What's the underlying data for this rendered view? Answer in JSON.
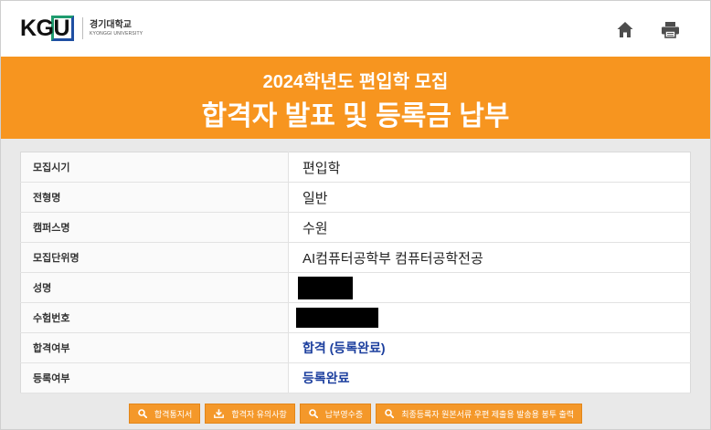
{
  "header": {
    "logo": {
      "mark": "KGU",
      "name_ko": "경기대학교",
      "name_en": "KYONGGI UNIVERSITY"
    },
    "icons": {
      "home": "home-icon",
      "print": "print-icon"
    }
  },
  "banner": {
    "subtitle": "2024학년도 편입학 모집",
    "title": "합격자 발표 및 등록금 납부"
  },
  "table": {
    "rows": [
      {
        "label": "모집시기",
        "value": "편입학"
      },
      {
        "label": "전형명",
        "value": "일반"
      },
      {
        "label": "캠퍼스명",
        "value": "수원"
      },
      {
        "label": "모집단위명",
        "value": "AI컴퓨터공학부 컴퓨터공학전공"
      },
      {
        "label": "성명"
      },
      {
        "label": "수험번호"
      },
      {
        "label": "합격여부",
        "value": "합격 (등록완료)"
      },
      {
        "label": "등록여부",
        "value": "등록완료"
      }
    ]
  },
  "actions": [
    {
      "label": "합격통지서",
      "icon": "search-icon"
    },
    {
      "label": "합격자 유의사항",
      "icon": "download-icon"
    },
    {
      "label": "납부영수증",
      "icon": "search-icon"
    },
    {
      "label": "최종등록자 원본서류 우편 제출용 발송용 봉투 출력",
      "icon": "search-icon"
    }
  ],
  "colors": {
    "accent": "#f7951f",
    "button": "#f4982a",
    "status_text": "#1c3f9e",
    "background": "#e9e9e9"
  }
}
